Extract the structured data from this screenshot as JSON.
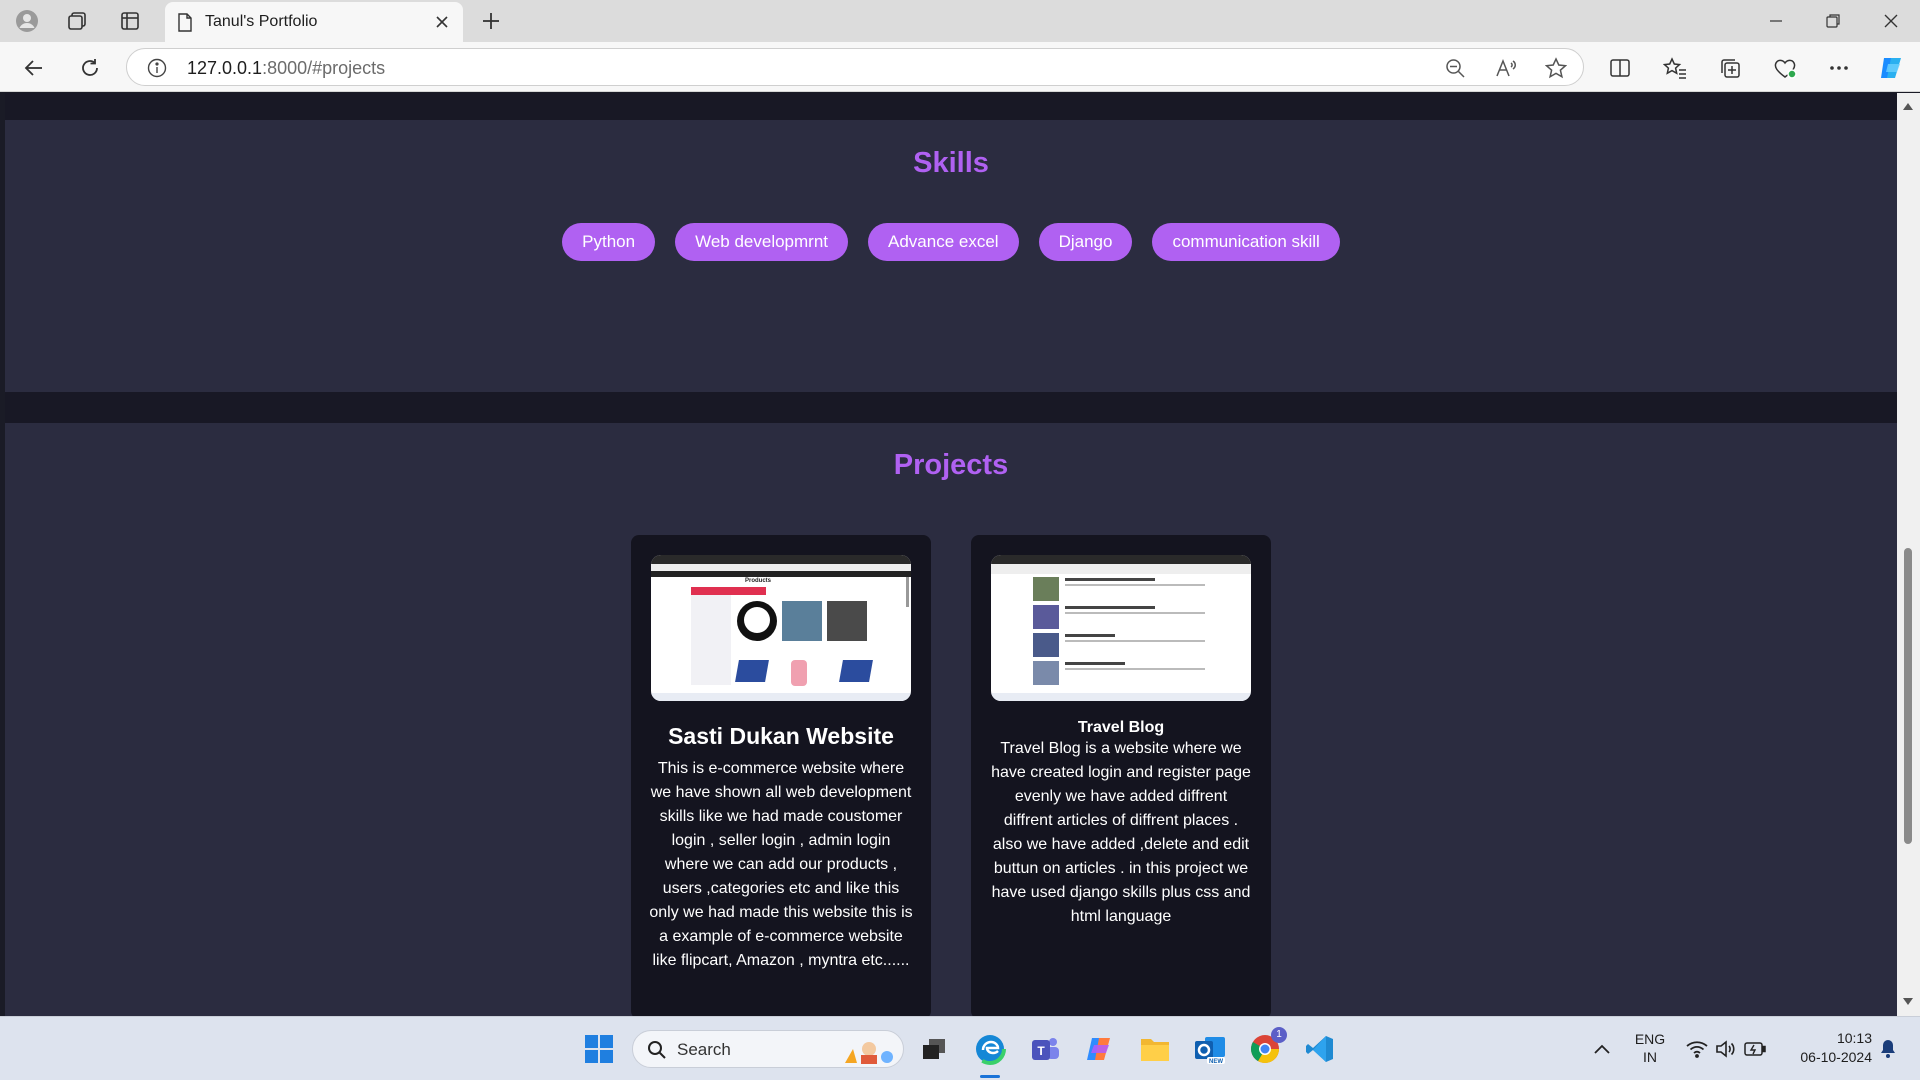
{
  "browser": {
    "tab_title": "Tanul's Portfolio",
    "url_host": "127.0.0.1",
    "url_rest": ":8000/#projects"
  },
  "skills": {
    "title": "Skills",
    "items": [
      "Python",
      "Web developmrnt",
      "Advance excel",
      "Django",
      "communication skill"
    ]
  },
  "projects": {
    "title": "Projects",
    "cards": [
      {
        "title": "Sasti Dukan Website",
        "description": "This is e-commerce website where we have shown all web development skills like we had made coustomer login , seller login , admin login where we can add our products , users ,categories etc and like this only we had made this website this is a example of e-commerce website like flipcart, Amazon , myntra etc......",
        "thumbnail_heading": "Products"
      },
      {
        "title": "Travel Blog",
        "description": "Travel Blog is a website where we have created login and register page evenly we have added diffrent diffrent articles of diffrent places . also we have added ,delete and edit buttun on articles . in this project we have used django skills plus css and html language"
      }
    ]
  },
  "taskbar": {
    "search_placeholder": "Search",
    "lang_line1": "ENG",
    "lang_line2": "IN",
    "time": "10:13",
    "date": "06-10-2024",
    "chrome_badge": "1"
  },
  "colors": {
    "accent": "#b061f2",
    "section_bg": "#2b2c40",
    "page_bg": "#181825",
    "card_bg": "#14141f"
  }
}
